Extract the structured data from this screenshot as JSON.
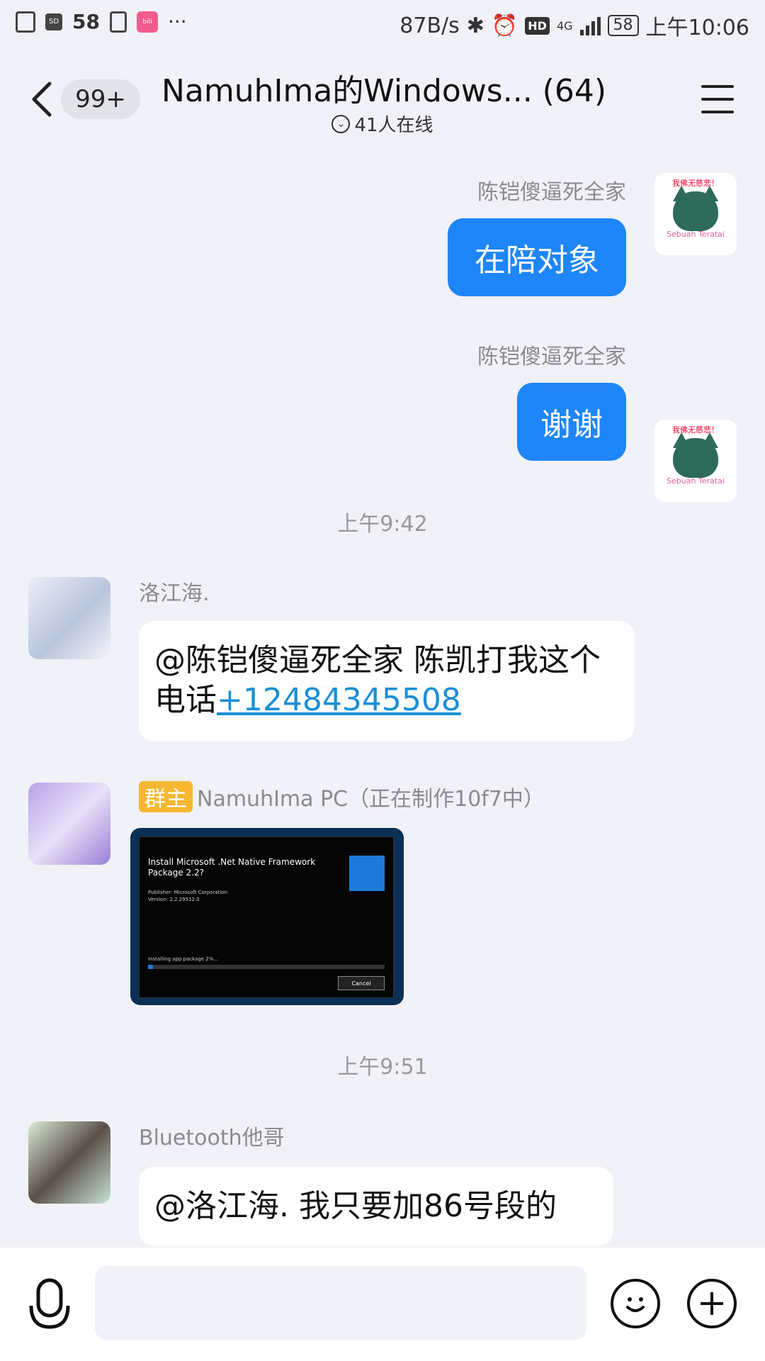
{
  "status_bar": {
    "notif_count": "58",
    "net_speed": "87B/s",
    "network": "4G",
    "battery": "58",
    "time": "上午10:06"
  },
  "header": {
    "unread_badge": "99+",
    "title": "NamuhIma的Windows... (64)",
    "online": "41人在线"
  },
  "messages": {
    "m1": {
      "sender": "陈铠傻逼死全家",
      "text": "在陪对象",
      "sticker_top": "我佛无慈悲！",
      "sticker_bottom": "Sebuah Teratai"
    },
    "m2": {
      "sender": "陈铠傻逼死全家",
      "text": "谢谢",
      "sticker_top": "我佛无慈悲！",
      "sticker_bottom": "Sebuah Teratai"
    },
    "ts1": "上午9:42",
    "m3": {
      "sender": "洛江海.",
      "text_part1": "@陈铠傻逼死全家 陈凯打我这个电话",
      "phone": "+12484345508"
    },
    "m4": {
      "tag": "群主",
      "sender": "NamuhIma PC（正在制作10f7中）",
      "image": {
        "title": "Install Microsoft .Net Native Framework Package 2.2?",
        "publisher": "Publisher: Microsoft Corporation",
        "version": "Version: 2.2.29512.0",
        "status": "Installing app package 2%...",
        "progress_percent": 2,
        "cancel": "Cancel"
      }
    },
    "ts2": "上午9:51",
    "m5": {
      "sender": "Bluetooth他哥",
      "text": "@洛江海. 我只要加86号段的"
    }
  },
  "input": {
    "placeholder": ""
  }
}
